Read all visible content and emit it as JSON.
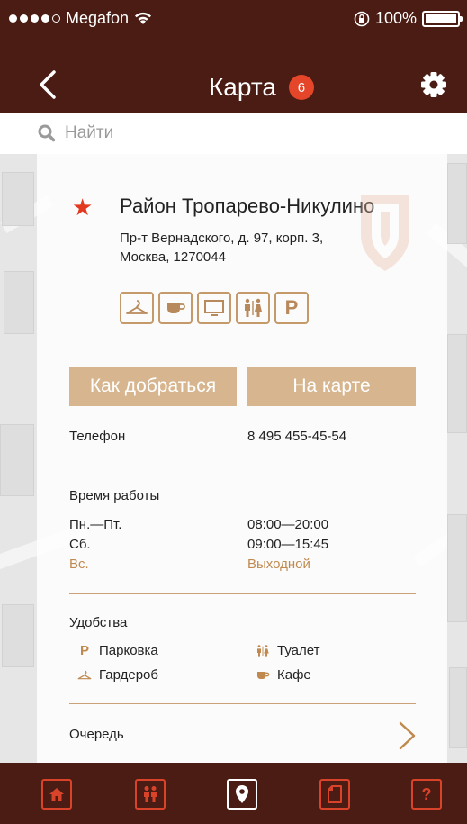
{
  "status": {
    "carrier": "Megafon",
    "battery": "100%"
  },
  "nav": {
    "title": "Карта",
    "badge": "6"
  },
  "search": {
    "placeholder": "Найти"
  },
  "place": {
    "name": "Район Тропарево-Никулино",
    "address": "Пр-т Вернадского, д. 97, корп. 3, Москва, 1270044",
    "amenity_icons": [
      "hanger-icon",
      "coffee-icon",
      "monitor-icon",
      "toilet-icon",
      "parking-icon"
    ],
    "parking_letter": "P"
  },
  "buttons": {
    "route": "Как добраться",
    "on_map": "На карте"
  },
  "phone": {
    "label": "Телефон",
    "value": "8 495 455-45-54"
  },
  "hours": {
    "label": "Время работы",
    "rows": [
      {
        "day": "Пн.—Пт.",
        "time": "08:00—20:00"
      },
      {
        "day": "Сб.",
        "time": "09:00—15:45"
      },
      {
        "day": "Вс.",
        "time": "Выходной"
      }
    ]
  },
  "facilities": {
    "label": "Удобства",
    "items": [
      {
        "icon": "parking-icon",
        "symbol": "P",
        "label": "Парковка"
      },
      {
        "icon": "toilet-icon",
        "symbol": "",
        "label": "Туалет"
      },
      {
        "icon": "hanger-icon",
        "symbol": "",
        "label": "Гардероб"
      },
      {
        "icon": "coffee-icon",
        "symbol": "",
        "label": "Кафе"
      }
    ]
  },
  "queue": {
    "label": "Очередь"
  },
  "tabbar": [
    "home-icon",
    "people-icon",
    "map-pin-icon",
    "document-icon",
    "help-icon"
  ],
  "tab_help_symbol": "?",
  "colors": {
    "header": "#4a1c14",
    "accent": "#c08a4f",
    "button": "#d7b58e",
    "badge": "#e5462a",
    "star": "#e23a20"
  }
}
